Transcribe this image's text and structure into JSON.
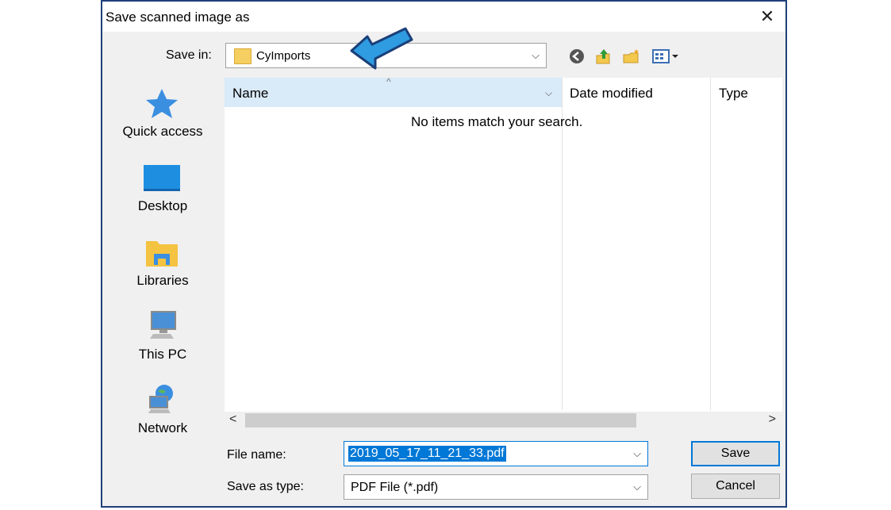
{
  "dialog": {
    "title": "Save scanned image as",
    "close_glyph": "✕"
  },
  "save_in": {
    "label": "Save in:",
    "value": "CyImports",
    "dropdown_glyph": "⌵"
  },
  "toolbar": {
    "icons": [
      "back-icon",
      "up-folder-icon",
      "new-folder-icon",
      "view-menu-icon"
    ]
  },
  "places": [
    {
      "label": "Quick access",
      "icon": "star-icon"
    },
    {
      "label": "Desktop",
      "icon": "desktop-icon"
    },
    {
      "label": "Libraries",
      "icon": "libraries-icon"
    },
    {
      "label": "This PC",
      "icon": "computer-icon"
    },
    {
      "label": "Network",
      "icon": "network-icon"
    }
  ],
  "file_list": {
    "columns": [
      "Name",
      "Date modified",
      "Type"
    ],
    "sort_glyph": "^",
    "column_menu_glyph": "⌵",
    "empty_message": "No items match your search.",
    "scroll_left_glyph": "<",
    "scroll_right_glyph": ">"
  },
  "file_name": {
    "label": "File name:",
    "value": "2019_05_17_11_21_33.pdf",
    "dropdown_glyph": "⌵"
  },
  "file_type": {
    "label": "Save as type:",
    "value": "PDF File (*.pdf)",
    "dropdown_glyph": "⌵"
  },
  "buttons": {
    "save": "Save",
    "cancel": "Cancel"
  },
  "colors": {
    "accent": "#0078d7",
    "annotation_arrow": "#2f9be0",
    "header_selected": "#d9eaf8"
  }
}
